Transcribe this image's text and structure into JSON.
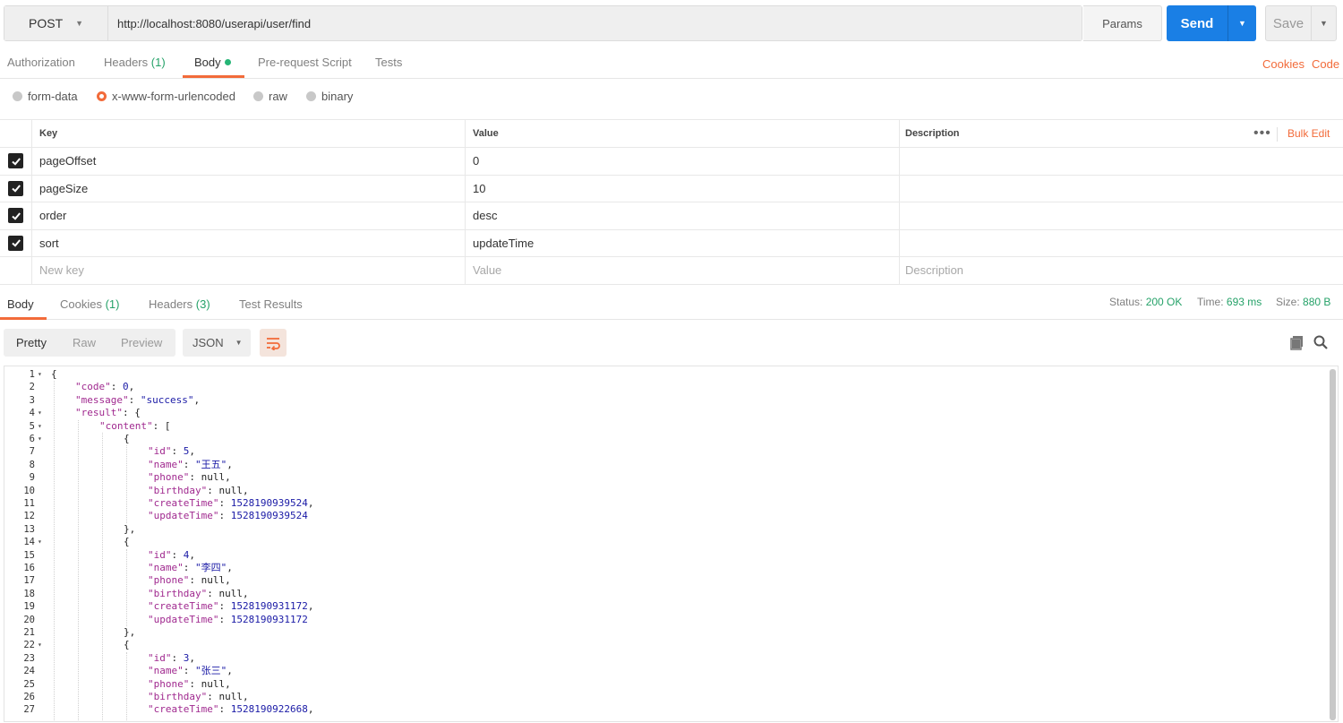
{
  "request": {
    "method": "POST",
    "url": "http://localhost:8080/userapi/user/find",
    "params_label": "Params",
    "send_label": "Send",
    "save_label": "Save"
  },
  "request_tabs": [
    {
      "label": "Authorization",
      "count": ""
    },
    {
      "label": "Headers",
      "count": "(1)"
    },
    {
      "label": "Body",
      "count": ""
    },
    {
      "label": "Pre-request Script",
      "count": ""
    },
    {
      "label": "Tests",
      "count": ""
    }
  ],
  "request_links": {
    "cookies": "Cookies",
    "code": "Code"
  },
  "body_types": [
    "form-data",
    "x-www-form-urlencoded",
    "raw",
    "binary"
  ],
  "selected_body_type": "x-www-form-urlencoded",
  "kv_table": {
    "headers": {
      "key": "Key",
      "value": "Value",
      "description": "Description"
    },
    "bulk_edit": "Bulk Edit",
    "more": "•••",
    "rows": [
      {
        "key": "pageOffset",
        "value": "0",
        "description": ""
      },
      {
        "key": "pageSize",
        "value": "10",
        "description": ""
      },
      {
        "key": "order",
        "value": "desc",
        "description": ""
      },
      {
        "key": "sort",
        "value": "updateTime",
        "description": ""
      }
    ],
    "new_row": {
      "key": "New key",
      "value": "Value",
      "description": "Description"
    }
  },
  "response_tabs": [
    {
      "label": "Body",
      "count": ""
    },
    {
      "label": "Cookies",
      "count": "(1)"
    },
    {
      "label": "Headers",
      "count": "(3)"
    },
    {
      "label": "Test Results",
      "count": ""
    }
  ],
  "response_status": {
    "status_label": "Status:",
    "status": "200 OK",
    "time_label": "Time:",
    "time": "693 ms",
    "size_label": "Size:",
    "size": "880 B"
  },
  "view_modes": [
    "Pretty",
    "Raw",
    "Preview"
  ],
  "format": "JSON",
  "icons": {
    "wrap": "wrap-lines-icon",
    "copy": "copy-icon",
    "search": "search-icon",
    "check": "check-icon"
  },
  "colors": {
    "accent": "#f26b3a",
    "send": "#1a7fe5",
    "success": "#26a269"
  },
  "code_lines": [
    {
      "n": "1",
      "fold": true,
      "indent": 0,
      "parts": [
        [
          "p",
          "{"
        ]
      ]
    },
    {
      "n": "2",
      "fold": false,
      "indent": 1,
      "parts": [
        [
          "k",
          "\"code\""
        ],
        [
          "p",
          ": "
        ],
        [
          "n",
          "0"
        ],
        [
          "p",
          ","
        ]
      ]
    },
    {
      "n": "3",
      "fold": false,
      "indent": 1,
      "parts": [
        [
          "k",
          "\"message\""
        ],
        [
          "p",
          ": "
        ],
        [
          "s",
          "\"success\""
        ],
        [
          "p",
          ","
        ]
      ]
    },
    {
      "n": "4",
      "fold": true,
      "indent": 1,
      "parts": [
        [
          "k",
          "\"result\""
        ],
        [
          "p",
          ": {"
        ]
      ]
    },
    {
      "n": "5",
      "fold": true,
      "indent": 2,
      "parts": [
        [
          "k",
          "\"content\""
        ],
        [
          "p",
          ": ["
        ]
      ]
    },
    {
      "n": "6",
      "fold": true,
      "indent": 3,
      "parts": [
        [
          "p",
          "{"
        ]
      ]
    },
    {
      "n": "7",
      "fold": false,
      "indent": 4,
      "parts": [
        [
          "k",
          "\"id\""
        ],
        [
          "p",
          ": "
        ],
        [
          "n",
          "5"
        ],
        [
          "p",
          ","
        ]
      ]
    },
    {
      "n": "8",
      "fold": false,
      "indent": 4,
      "parts": [
        [
          "k",
          "\"name\""
        ],
        [
          "p",
          ": "
        ],
        [
          "s",
          "\"王五\""
        ],
        [
          "p",
          ","
        ]
      ]
    },
    {
      "n": "9",
      "fold": false,
      "indent": 4,
      "parts": [
        [
          "k",
          "\"phone\""
        ],
        [
          "p",
          ": null,"
        ]
      ]
    },
    {
      "n": "10",
      "fold": false,
      "indent": 4,
      "parts": [
        [
          "k",
          "\"birthday\""
        ],
        [
          "p",
          ": null,"
        ]
      ]
    },
    {
      "n": "11",
      "fold": false,
      "indent": 4,
      "parts": [
        [
          "k",
          "\"createTime\""
        ],
        [
          "p",
          ": "
        ],
        [
          "n",
          "1528190939524"
        ],
        [
          "p",
          ","
        ]
      ]
    },
    {
      "n": "12",
      "fold": false,
      "indent": 4,
      "parts": [
        [
          "k",
          "\"updateTime\""
        ],
        [
          "p",
          ": "
        ],
        [
          "n",
          "1528190939524"
        ]
      ]
    },
    {
      "n": "13",
      "fold": false,
      "indent": 3,
      "parts": [
        [
          "p",
          "},"
        ]
      ]
    },
    {
      "n": "14",
      "fold": true,
      "indent": 3,
      "parts": [
        [
          "p",
          "{"
        ]
      ]
    },
    {
      "n": "15",
      "fold": false,
      "indent": 4,
      "parts": [
        [
          "k",
          "\"id\""
        ],
        [
          "p",
          ": "
        ],
        [
          "n",
          "4"
        ],
        [
          "p",
          ","
        ]
      ]
    },
    {
      "n": "16",
      "fold": false,
      "indent": 4,
      "parts": [
        [
          "k",
          "\"name\""
        ],
        [
          "p",
          ": "
        ],
        [
          "s",
          "\"李四\""
        ],
        [
          "p",
          ","
        ]
      ]
    },
    {
      "n": "17",
      "fold": false,
      "indent": 4,
      "parts": [
        [
          "k",
          "\"phone\""
        ],
        [
          "p",
          ": null,"
        ]
      ]
    },
    {
      "n": "18",
      "fold": false,
      "indent": 4,
      "parts": [
        [
          "k",
          "\"birthday\""
        ],
        [
          "p",
          ": null,"
        ]
      ]
    },
    {
      "n": "19",
      "fold": false,
      "indent": 4,
      "parts": [
        [
          "k",
          "\"createTime\""
        ],
        [
          "p",
          ": "
        ],
        [
          "n",
          "1528190931172"
        ],
        [
          "p",
          ","
        ]
      ]
    },
    {
      "n": "20",
      "fold": false,
      "indent": 4,
      "parts": [
        [
          "k",
          "\"updateTime\""
        ],
        [
          "p",
          ": "
        ],
        [
          "n",
          "1528190931172"
        ]
      ]
    },
    {
      "n": "21",
      "fold": false,
      "indent": 3,
      "parts": [
        [
          "p",
          "},"
        ]
      ]
    },
    {
      "n": "22",
      "fold": true,
      "indent": 3,
      "parts": [
        [
          "p",
          "{"
        ]
      ]
    },
    {
      "n": "23",
      "fold": false,
      "indent": 4,
      "parts": [
        [
          "k",
          "\"id\""
        ],
        [
          "p",
          ": "
        ],
        [
          "n",
          "3"
        ],
        [
          "p",
          ","
        ]
      ]
    },
    {
      "n": "24",
      "fold": false,
      "indent": 4,
      "parts": [
        [
          "k",
          "\"name\""
        ],
        [
          "p",
          ": "
        ],
        [
          "s",
          "\"张三\""
        ],
        [
          "p",
          ","
        ]
      ]
    },
    {
      "n": "25",
      "fold": false,
      "indent": 4,
      "parts": [
        [
          "k",
          "\"phone\""
        ],
        [
          "p",
          ": null,"
        ]
      ]
    },
    {
      "n": "26",
      "fold": false,
      "indent": 4,
      "parts": [
        [
          "k",
          "\"birthday\""
        ],
        [
          "p",
          ": null,"
        ]
      ]
    },
    {
      "n": "27",
      "fold": false,
      "indent": 4,
      "parts": [
        [
          "k",
          "\"createTime\""
        ],
        [
          "p",
          ": "
        ],
        [
          "n",
          "1528190922668"
        ],
        [
          "p",
          ","
        ]
      ]
    }
  ]
}
